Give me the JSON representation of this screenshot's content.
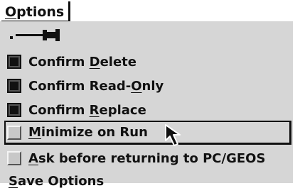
{
  "menu": {
    "title_mnemonic": "O",
    "title_rest": "ptions",
    "items": [
      {
        "pre": "Confirm ",
        "mnemonic": "D",
        "post": "elete",
        "checked": true
      },
      {
        "pre": "Confirm Read-",
        "mnemonic": "O",
        "post": "nly",
        "checked": true
      },
      {
        "pre": "Confirm ",
        "mnemonic": "R",
        "post": "eplace",
        "checked": true
      },
      {
        "pre": "",
        "mnemonic": "M",
        "post": "inimize on Run",
        "checked": false,
        "selected": true
      },
      {
        "pre": "",
        "mnemonic": "A",
        "post": "sk before returning to PC/GEOS",
        "checked": false
      }
    ],
    "save": {
      "mnemonic": "S",
      "post": "ave Options"
    }
  },
  "icons": {
    "pin": "pushpin-icon",
    "cursor": "mouse-pointer-icon"
  }
}
